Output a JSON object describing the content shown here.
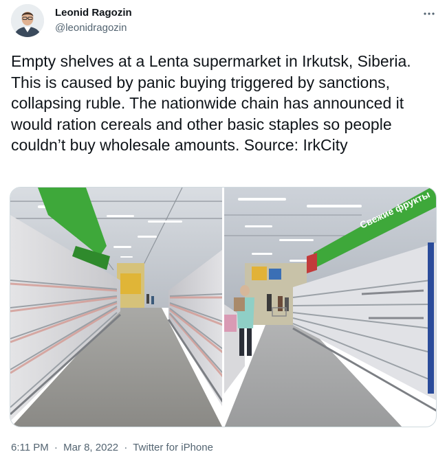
{
  "author": {
    "display_name": "Leonid Ragozin",
    "handle": "@leonidragozin",
    "avatar_icon": "profile-photo"
  },
  "more_icon": "more-dots-icon",
  "tweet": {
    "text": "Empty shelves at a Lenta supermarket in Irkutsk, Siberia. This is caused by panic buying triggered by sanctions, collapsing ruble. The nationwide chain has announced it would ration cereals and other basic staples so people couldn’t buy wholesale amounts. Source: IrkCity"
  },
  "media": {
    "photos": [
      {
        "alt": "photo-empty-shelves-aisle-left"
      },
      {
        "alt": "photo-empty-shelves-aisle-right"
      }
    ],
    "sign_text": "Свежие фрукты"
  },
  "footer": {
    "time": "6:11 PM",
    "date": "Mar 8, 2022",
    "source": "Twitter for iPhone",
    "separator": "·"
  },
  "colors": {
    "text": "#0f1419",
    "secondary": "#536471",
    "border": "#cfd9de",
    "sign_green": "#3ea83a"
  }
}
